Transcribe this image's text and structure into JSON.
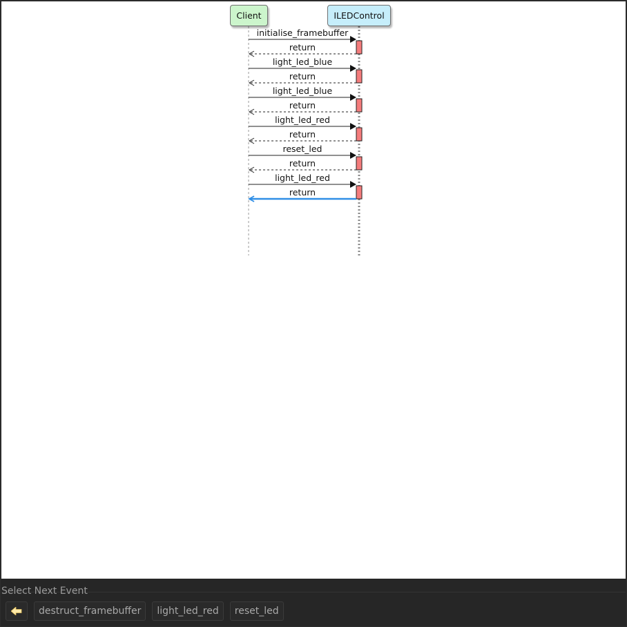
{
  "diagram": {
    "participants": [
      {
        "id": "client",
        "label": "Client",
        "color": "#ccf5cc"
      },
      {
        "id": "iled",
        "label": "ILEDControl",
        "color": "#c6eefb"
      }
    ],
    "messages": [
      {
        "label": "initialise_framebuffer",
        "kind": "call"
      },
      {
        "label": "return",
        "kind": "return"
      },
      {
        "label": "light_led_blue",
        "kind": "call"
      },
      {
        "label": "return",
        "kind": "return"
      },
      {
        "label": "light_led_blue",
        "kind": "call"
      },
      {
        "label": "return",
        "kind": "return"
      },
      {
        "label": "light_led_red",
        "kind": "call"
      },
      {
        "label": "return",
        "kind": "return"
      },
      {
        "label": "reset_led",
        "kind": "call"
      },
      {
        "label": "return",
        "kind": "return"
      },
      {
        "label": "light_led_red",
        "kind": "call"
      },
      {
        "label": "return",
        "kind": "return",
        "highlighted": true
      }
    ],
    "activation_color": "#f47c7c",
    "highlight_color": "#2f8ee6"
  },
  "panel": {
    "title": "Select Next Event",
    "back_icon": "arrow-left-icon",
    "events": [
      "destruct_framebuffer",
      "light_led_red",
      "reset_led"
    ]
  }
}
